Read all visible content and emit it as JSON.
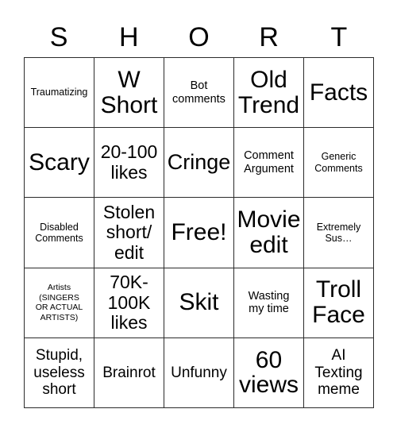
{
  "card": {
    "title_letters": [
      "S",
      "H",
      "O",
      "R",
      "T"
    ],
    "columns": 5,
    "rows": 5,
    "colors": {
      "background": "#ffffff",
      "grid_line": "#2b2b2b",
      "text": "#000000"
    },
    "cells": [
      {
        "text": "Traumatizing",
        "size": "xs",
        "row": 1,
        "col": 1
      },
      {
        "text": "W\nShort",
        "size": "xxl",
        "row": 1,
        "col": 2
      },
      {
        "text": "Bot\ncomments",
        "size": "s",
        "row": 1,
        "col": 3
      },
      {
        "text": "Old\nTrend",
        "size": "xxl",
        "row": 1,
        "col": 4
      },
      {
        "text": "Facts",
        "size": "xxl",
        "row": 1,
        "col": 5
      },
      {
        "text": "Scary",
        "size": "xxl",
        "row": 2,
        "col": 1
      },
      {
        "text": "20-100\nlikes",
        "size": "l",
        "row": 2,
        "col": 2
      },
      {
        "text": "Cringe",
        "size": "xl",
        "row": 2,
        "col": 3
      },
      {
        "text": "Comment\nArgument",
        "size": "s",
        "row": 2,
        "col": 4
      },
      {
        "text": "Generic\nComments",
        "size": "xs",
        "row": 2,
        "col": 5
      },
      {
        "text": "Disabled\nComments",
        "size": "xs",
        "row": 3,
        "col": 1
      },
      {
        "text": "Stolen\nshort/\nedit",
        "size": "l",
        "row": 3,
        "col": 2
      },
      {
        "text": "Free!",
        "size": "xxl",
        "row": 3,
        "col": 3
      },
      {
        "text": "Movie\nedit",
        "size": "xxl",
        "row": 3,
        "col": 4
      },
      {
        "text": "Extremely\nSus…",
        "size": "xs",
        "row": 3,
        "col": 5
      },
      {
        "text": "Artists\n(SINGERS\nOR ACTUAL\nARTISTS)",
        "size": "xxs",
        "row": 4,
        "col": 1
      },
      {
        "text": "70K-\n100K\nlikes",
        "size": "l",
        "row": 4,
        "col": 2
      },
      {
        "text": "Skit",
        "size": "xxl",
        "row": 4,
        "col": 3
      },
      {
        "text": "Wasting\nmy time",
        "size": "s",
        "row": 4,
        "col": 4
      },
      {
        "text": "Troll\nFace",
        "size": "xxl",
        "row": 4,
        "col": 5
      },
      {
        "text": "Stupid,\nuseless\nshort",
        "size": "m",
        "row": 5,
        "col": 1
      },
      {
        "text": "Brainrot",
        "size": "m",
        "row": 5,
        "col": 2
      },
      {
        "text": "Unfunny",
        "size": "m",
        "row": 5,
        "col": 3
      },
      {
        "text": "60\nviews",
        "size": "xxl",
        "row": 5,
        "col": 4
      },
      {
        "text": "AI\nTexting\nmeme",
        "size": "m",
        "row": 5,
        "col": 5
      }
    ]
  }
}
